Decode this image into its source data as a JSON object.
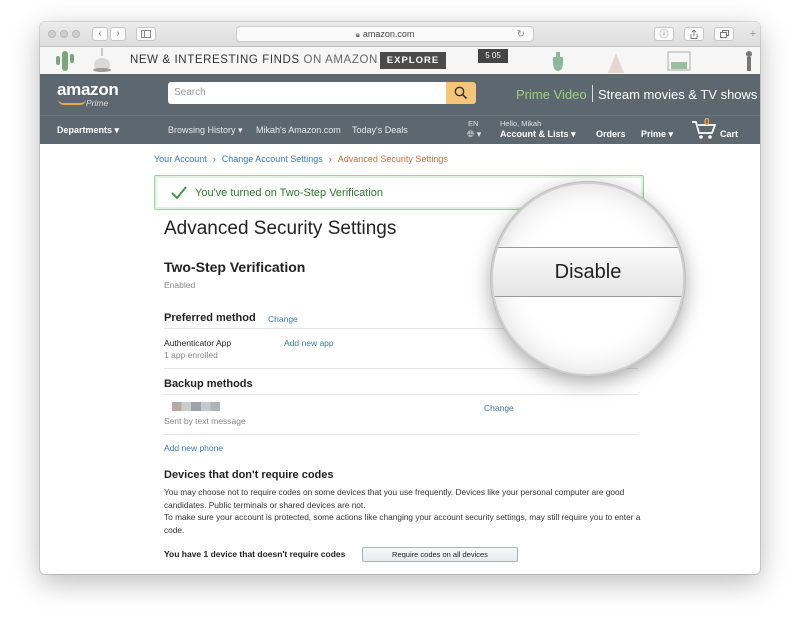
{
  "browser": {
    "url": "amazon.com"
  },
  "promo": {
    "text_main": "NEW & INTERESTING FINDS",
    "text_on": "ON AMAZON",
    "explore_label": "EXPLORE",
    "clock_text": "5 05"
  },
  "header": {
    "logo": "amazon",
    "logo_sub": "Prime",
    "search_placeholder": "Search",
    "prime_video": "Prime Video",
    "stream": "Stream movies & TV shows"
  },
  "nav": {
    "departments": "Departments",
    "browsing_history": "Browsing History",
    "mikahs_amazon": "Mikah's Amazon.com",
    "todays_deals": "Today's Deals",
    "lang": "EN",
    "hello": "Hello, Mikah",
    "account": "Account & Lists",
    "orders": "Orders",
    "prime": "Prime",
    "cart_count": "0",
    "cart": "Cart"
  },
  "breadcrumb": {
    "items": [
      "Your Account",
      "Change Account Settings",
      "Advanced Security Settings"
    ]
  },
  "alert": {
    "message": "You've turned on Two-Step Verification"
  },
  "page": {
    "title": "Advanced Security Settings",
    "tsv_heading": "Two-Step Verification",
    "tsv_status": "Enabled",
    "preferred_heading": "Preferred method",
    "preferred_change": "Change",
    "auth_app": "Authenticator App",
    "auth_enrolled": "1 app enrolled",
    "add_new_app": "Add new app",
    "backup_heading": "Backup methods",
    "backup_change": "Change",
    "sent_by": "Sent by text message",
    "add_new_phone": "Add new phone",
    "devices_heading": "Devices that don't require codes",
    "devices_para1": "You may choose not to require codes on some devices that you use frequently. Devices like your personal computer are good candidates. Public terminals or shared devices are not.",
    "devices_para2": "To make sure your account is protected, some actions like changing your account security settings, may still require you to enter a code.",
    "devices_count": "You have 1 device that doesn't require codes",
    "require_codes_btn": "Require codes on all devices"
  },
  "magnifier": {
    "disable_label": "Disable"
  },
  "colors": {
    "header_bg": "#5d6770",
    "link": "#3a7bb8",
    "breadcrumb_current": "#d0693e",
    "success": "#2b7a2b",
    "prime_video": "#9fd07a",
    "search_button": "#f5c57a"
  }
}
